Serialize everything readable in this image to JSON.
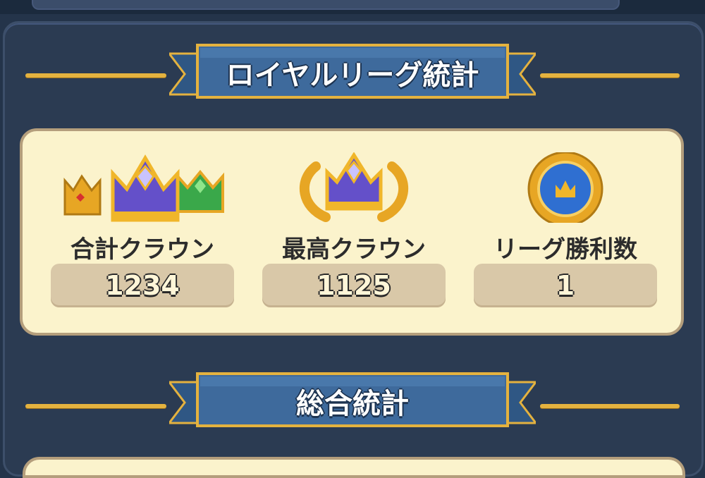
{
  "royal_league": {
    "title": "ロイヤルリーグ統計",
    "stats": [
      {
        "label": "合計クラウン",
        "value": "1234",
        "icon": "crowns-group-icon"
      },
      {
        "label": "最高クラウン",
        "value": "1125",
        "icon": "laurel-crown-icon"
      },
      {
        "label": "リーグ勝利数",
        "value": "1",
        "icon": "crown-medal-icon"
      }
    ]
  },
  "overall": {
    "title": "総合統計"
  },
  "colors": {
    "background": "#24344a",
    "panel": "#2b3b52",
    "ribbon": "#3e6a9c",
    "gold": "#e4b23f",
    "card": "#fbf3cc",
    "value_box": "#d9c8a8"
  }
}
